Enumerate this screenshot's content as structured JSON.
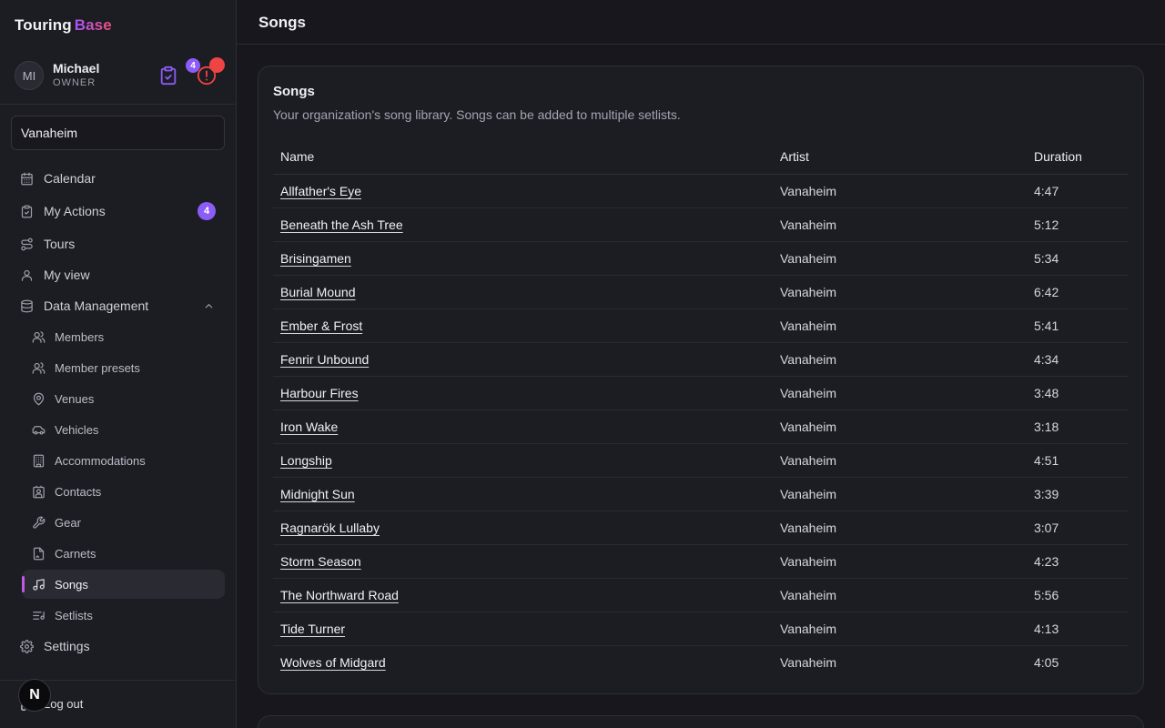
{
  "brand": {
    "part1": "Touring",
    "part2": "Base"
  },
  "user": {
    "initials": "MI",
    "name": "Michael",
    "role": "OWNER",
    "actions_count": "4"
  },
  "org_select": {
    "value": "Vanaheim"
  },
  "nav": {
    "calendar": "Calendar",
    "my_actions": "My Actions",
    "my_actions_count": "4",
    "tours": "Tours",
    "my_view": "My view",
    "data_management": "Data Management",
    "settings": "Settings",
    "logout": "Log out"
  },
  "sub_nav": {
    "members": "Members",
    "member_presets": "Member presets",
    "venues": "Venues",
    "vehicles": "Vehicles",
    "accommodations": "Accommodations",
    "contacts": "Contacts",
    "gear": "Gear",
    "carnets": "Carnets",
    "songs": "Songs",
    "setlists": "Setlists"
  },
  "n_badge": "N",
  "page": {
    "title": "Songs"
  },
  "card": {
    "title": "Songs",
    "subtitle": "Your organization's song library. Songs can be added to multiple setlists."
  },
  "table": {
    "headers": {
      "name": "Name",
      "artist": "Artist",
      "duration": "Duration"
    },
    "rows": [
      {
        "name": "Allfather's Eye",
        "artist": "Vanaheim",
        "duration": "4:47"
      },
      {
        "name": "Beneath the Ash Tree",
        "artist": "Vanaheim",
        "duration": "5:12"
      },
      {
        "name": "Brisingamen",
        "artist": "Vanaheim",
        "duration": "5:34"
      },
      {
        "name": "Burial Mound",
        "artist": "Vanaheim",
        "duration": "6:42"
      },
      {
        "name": "Ember & Frost",
        "artist": "Vanaheim",
        "duration": "5:41"
      },
      {
        "name": "Fenrir Unbound",
        "artist": "Vanaheim",
        "duration": "4:34"
      },
      {
        "name": "Harbour Fires",
        "artist": "Vanaheim",
        "duration": "3:48"
      },
      {
        "name": "Iron Wake",
        "artist": "Vanaheim",
        "duration": "3:18"
      },
      {
        "name": "Longship",
        "artist": "Vanaheim",
        "duration": "4:51"
      },
      {
        "name": "Midnight Sun",
        "artist": "Vanaheim",
        "duration": "3:39"
      },
      {
        "name": "Ragnarök Lullaby",
        "artist": "Vanaheim",
        "duration": "3:07"
      },
      {
        "name": "Storm Season",
        "artist": "Vanaheim",
        "duration": "4:23"
      },
      {
        "name": "The Northward Road",
        "artist": "Vanaheim",
        "duration": "5:56"
      },
      {
        "name": "Tide Turner",
        "artist": "Vanaheim",
        "duration": "4:13"
      },
      {
        "name": "Wolves of Midgard",
        "artist": "Vanaheim",
        "duration": "4:05"
      }
    ]
  },
  "colors": {
    "accent": "#8b5cf6",
    "active_marker": "#c05ae6",
    "alert": "#ef4444",
    "background": "#17171d"
  }
}
